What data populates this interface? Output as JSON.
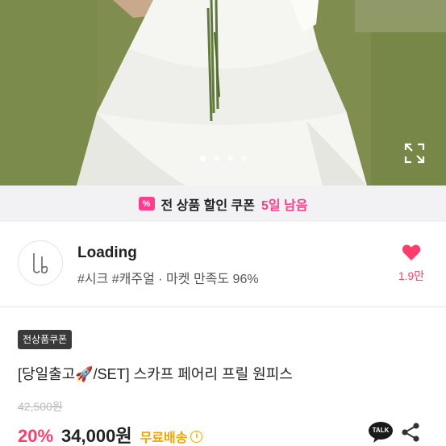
{
  "photo": {
    "slide_count": 4,
    "active_slide": 1,
    "expand_icon": "expand-icon"
  },
  "coupon_bar": {
    "icon": "coupon-percent-icon",
    "icon_glyph": "%",
    "text": "전 상품 할인 쿠폰",
    "highlight": "5일 남음",
    "accent": "#ff3d8b"
  },
  "shop": {
    "name": "Loading",
    "tags": "#시크 #캐주얼 · 마켓 만족도 96%",
    "like_count": "1.9만",
    "like_icon": "heart-icon",
    "like_color": "#ff3d6b"
  },
  "product": {
    "badge": "전상품쿠폰",
    "title": "[당일출고🚀/SET] 스카프 페어리 프릴 원피스",
    "original_price": "42,500원",
    "discount": "20%",
    "price": "34,000원",
    "shipping": "무료배송",
    "shipping_color": "#f0a500",
    "talk_label": "TALK",
    "share_icon": "share-icon"
  }
}
